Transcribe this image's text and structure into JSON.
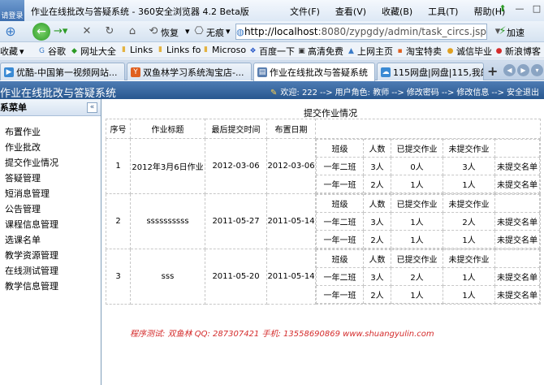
{
  "browser": {
    "avatar_text": "请登录",
    "title": "作业在线批改与答疑系统 - 360安全浏览器 4.2 Beta版",
    "menus": [
      "文件(F)",
      "查看(V)",
      "收藏(B)",
      "工具(T)",
      "帮助(H)"
    ],
    "restore_label": "恢复",
    "mode_label": "无痕",
    "url_host": "http://localhost",
    "url_rest": ":8080/zypgdy/admin/task_circs.jsp",
    "accelerate_label": "加速",
    "bookmarks": [
      "收藏",
      "谷歌",
      "网址大全",
      "Links",
      "Links fo",
      "Microso",
      "百度一下",
      "高清免费",
      "上网主页",
      "淘宝特卖",
      "诚信毕业",
      "新浪博客"
    ],
    "tabs": [
      {
        "label": "优酷-中国第一视频网站..."
      },
      {
        "label": "双鱼林学习系统淘宝店-..."
      },
      {
        "label": "作业在线批改与答疑系统"
      },
      {
        "label": "115网盘|网盘|115,我的..."
      }
    ]
  },
  "app": {
    "title": "作业在线批改与答疑系统",
    "welcome": "欢迎: 222",
    "role": "用户角色: 教师",
    "change_password": "修改密码",
    "change_info": "修改信息",
    "logout": "安全退出",
    "arrow": "-->"
  },
  "sidebar": {
    "header": "系菜单",
    "items": [
      "布置作业",
      "作业批改",
      "提交作业情况",
      "答疑管理",
      "短消息管理",
      "公告管理",
      "课程信息管理",
      "选课名单",
      "教学资源管理",
      "在线测试管理",
      "教学信息管理"
    ]
  },
  "main": {
    "title": "提交作业情况",
    "headers": [
      "序号",
      "作业标题",
      "最后提交时间",
      "布置日期"
    ],
    "sub_headers": [
      "班级",
      "人数",
      "已提交作业",
      "未提交作业"
    ],
    "link_label": "未提交名单",
    "rows": [
      {
        "no": "1",
        "title": "2012年3月6日作业",
        "last_submit": "2012-03-06",
        "assign_date": "2012-03-06",
        "classes": [
          {
            "name": "一年二班",
            "count": "3人",
            "submitted": "0人",
            "unsubmitted": "3人"
          },
          {
            "name": "一年一班",
            "count": "2人",
            "submitted": "1人",
            "unsubmitted": "1人"
          }
        ]
      },
      {
        "no": "2",
        "title": "ssssssssss",
        "last_submit": "2011-05-27",
        "assign_date": "2011-05-14",
        "classes": [
          {
            "name": "一年二班",
            "count": "3人",
            "submitted": "1人",
            "unsubmitted": "2人"
          },
          {
            "name": "一年一班",
            "count": "2人",
            "submitted": "1人",
            "unsubmitted": "1人"
          }
        ]
      },
      {
        "no": "3",
        "title": "sss",
        "last_submit": "2011-05-20",
        "assign_date": "2011-05-14",
        "classes": [
          {
            "name": "一年二班",
            "count": "3人",
            "submitted": "2人",
            "unsubmitted": "1人"
          },
          {
            "name": "一年一班",
            "count": "2人",
            "submitted": "1人",
            "unsubmitted": "1人"
          }
        ]
      }
    ],
    "footer": "程序测试: 双鱼林  QQ: 287307421  手机: 13558690869  www.shuangyulin.com"
  }
}
